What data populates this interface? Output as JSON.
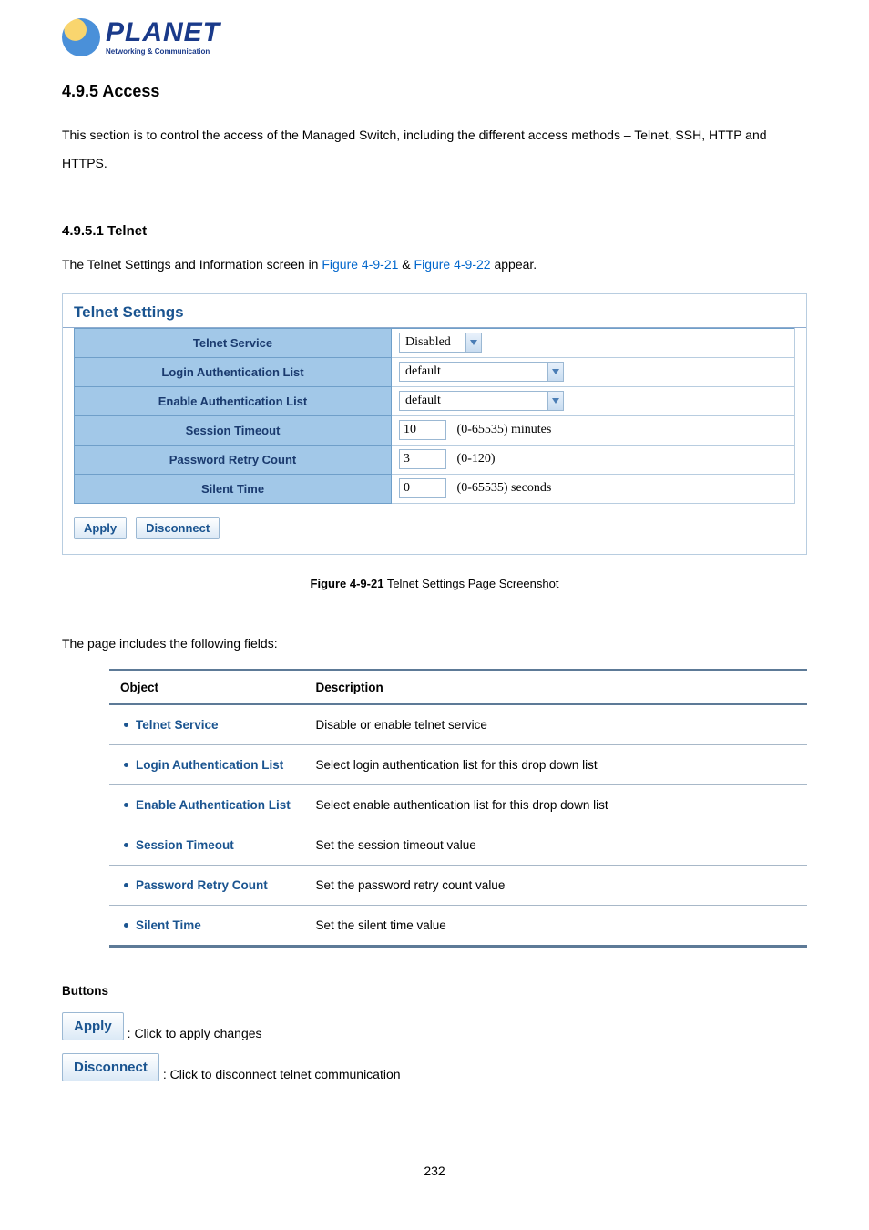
{
  "logo": {
    "brand": "PLANET",
    "tagline": "Networking & Communication"
  },
  "heading_section": "4.9.5 Access",
  "intro_text": "This section is to control the access of the Managed Switch, including the different access methods – Telnet, SSH, HTTP and HTTPS.",
  "heading_sub": "4.9.5.1 Telnet",
  "sub_intro_pre": "The Telnet Settings and Information screen in ",
  "sub_intro_link1": "Figure 4-9-21",
  "sub_intro_amp": " & ",
  "sub_intro_link2": "Figure 4-9-22",
  "sub_intro_post": " appear.",
  "panel": {
    "title": "Telnet Settings",
    "rows": [
      {
        "label": "Telnet Service",
        "type": "select",
        "value": "Disabled",
        "wide": false
      },
      {
        "label": "Login Authentication List",
        "type": "select",
        "value": "default",
        "wide": true
      },
      {
        "label": "Enable Authentication List",
        "type": "select",
        "value": "default",
        "wide": true
      },
      {
        "label": "Session Timeout",
        "type": "number",
        "value": "10",
        "hint": "(0-65535) minutes"
      },
      {
        "label": "Password Retry Count",
        "type": "number",
        "value": "3",
        "hint": "(0-120)"
      },
      {
        "label": "Silent Time",
        "type": "number",
        "value": "0",
        "hint": "(0-65535) seconds"
      }
    ],
    "buttons": {
      "apply": "Apply",
      "disconnect": "Disconnect"
    }
  },
  "caption": {
    "label": "Figure 4-9-21",
    "text": " Telnet Settings Page Screenshot"
  },
  "fields_intro": "The page includes the following fields:",
  "desc_table": {
    "head_object": "Object",
    "head_desc": "Description",
    "rows": [
      {
        "obj": "Telnet Service",
        "desc": "Disable or enable telnet service"
      },
      {
        "obj": "Login Authentication List",
        "desc": "Select login authentication list for this drop down list"
      },
      {
        "obj": "Enable Authentication List",
        "desc": "Select enable authentication list for this drop down list"
      },
      {
        "obj": "Session Timeout",
        "desc": "Set the session timeout value"
      },
      {
        "obj": "Password Retry Count",
        "desc": "Set the password retry count value"
      },
      {
        "obj": "Silent Time",
        "desc": "Set the silent time value"
      }
    ]
  },
  "buttons_heading": "Buttons",
  "btn_explains": [
    {
      "btn": "Apply",
      "text": ": Click to apply changes"
    },
    {
      "btn": "Disconnect",
      "text": ": Click to disconnect telnet communication"
    }
  ],
  "page_number": "232"
}
